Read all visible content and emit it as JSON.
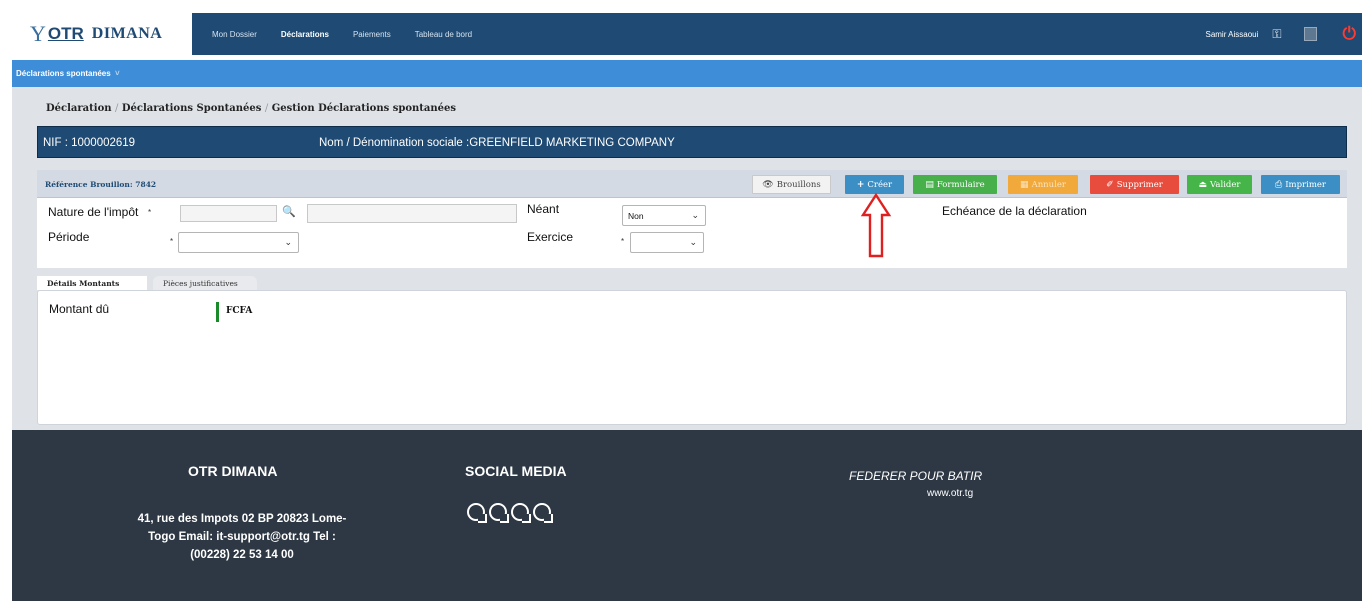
{
  "header": {
    "logo_otr": "OTR",
    "logo_dimana": "DIMANA",
    "nav": [
      "Mon Dossier",
      "Déclarations",
      "Paiements",
      "Tableau de bord"
    ],
    "active_nav": "Déclarations",
    "user_name": "Samir  Aissaoui"
  },
  "subnav": {
    "label": "Déclarations spontanées"
  },
  "breadcrumb": {
    "items": [
      "Déclaration",
      "Déclarations Spontanées",
      "Gestion Déclarations spontanées"
    ],
    "separator": "/"
  },
  "taxpayer": {
    "nif": "NIF : 1000002619",
    "nom": "Nom / Dénomination sociale :GREENFIELD MARKETING COMPANY"
  },
  "toolbar": {
    "reference": "Référence Brouillon: 7842",
    "buttons": {
      "brouillons": "Brouillons",
      "creer": "Créer",
      "formulaire": "Formulaire",
      "annuler": "Annuler",
      "supprimer": "Supprimer",
      "valider": "Valider",
      "imprimer": "Imprimer"
    },
    "colors": {
      "brouillons": "#f2f2f2",
      "creer": "#3b8fc4",
      "formulaire": "#47b04b",
      "annuler": "#f2a93b",
      "supprimer": "#e74c3c",
      "valider": "#45b549",
      "imprimer": "#3b8fc4"
    }
  },
  "form": {
    "nature_label": "Nature de l'impôt",
    "nature_code": "",
    "nature_libelle": "",
    "periode_label": "Période",
    "periode_value": "",
    "neant_label": "Néant",
    "neant_value": "Non",
    "exercice_label": "Exercice",
    "exercice_value": "",
    "echeance_label": "Echéance de la déclaration",
    "required_mark": "*"
  },
  "tabs": [
    "Détails Montants",
    "Pièces justificatives"
  ],
  "details": {
    "montant_label": "Montant dû",
    "currency": "FCFA"
  },
  "footer": {
    "title": "OTR DIMANA",
    "address": "41, rue des Impots 02 BP 20823 Lome-Togo Email: it-support@otr.tg Tel : (00228) 22 53 14 00",
    "social_title": "SOCIAL MEDIA",
    "slogan": "FEDERER POUR BATIR",
    "website": "www.otr.tg"
  },
  "theme": {
    "primary": "#1e4a73",
    "accent": "#3e8dd8",
    "annotation_arrow": "#e02020"
  }
}
